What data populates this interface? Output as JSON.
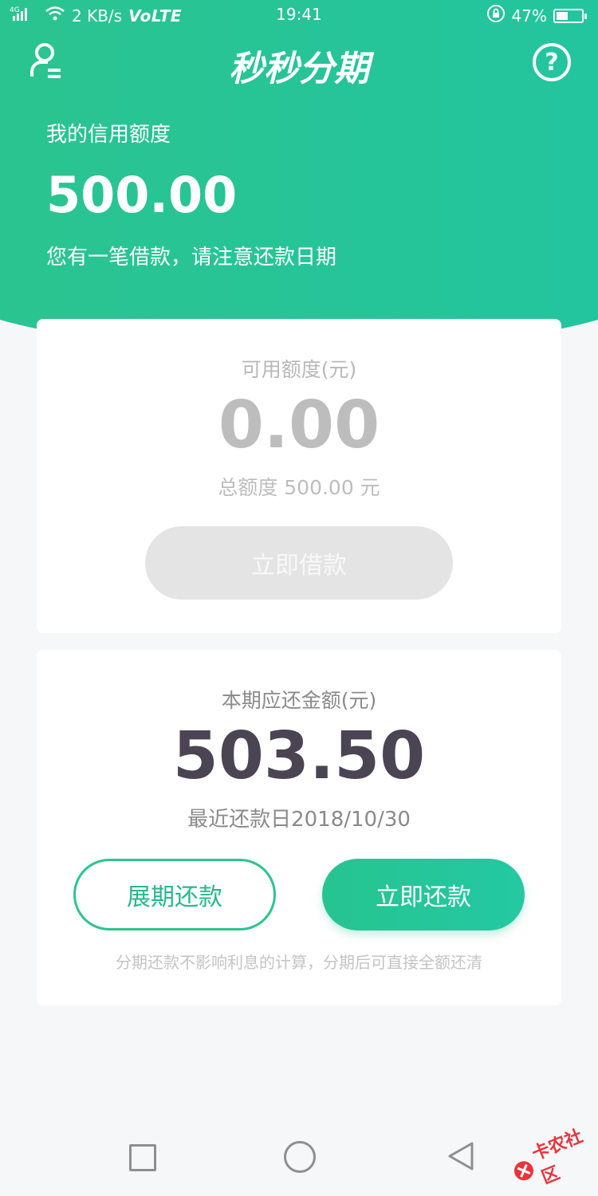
{
  "status_bar": {
    "network": "4G",
    "speed": "2 KB/s",
    "volte": "VoLTE",
    "time": "19:41",
    "battery_percent": "47%",
    "battery_level": 0.47
  },
  "header": {
    "title": "秒秒分期",
    "user_icon": "user-account-icon",
    "help_icon": "help-circle-icon",
    "help_glyph": "?"
  },
  "hero": {
    "label": "我的信用额度",
    "amount": "500.00",
    "notice": "您有一笔借款，请注意还款日期"
  },
  "credit_card": {
    "label": "可用额度(元)",
    "value": "0.00",
    "total": "总额度 500.00 元",
    "borrow_button": "立即借款"
  },
  "repay_card": {
    "label": "本期应还金额(元)",
    "amount": "503.50",
    "due_date": "最近还款日2018/10/30",
    "extend_button": "展期还款",
    "repay_button": "立即还款",
    "tip": "分期还款不影响利息的计算，分期后可直接全额还清"
  },
  "nav": {
    "recent_icon": "recent-apps-icon",
    "home_icon": "home-icon",
    "back_icon": "back-icon"
  },
  "watermark": {
    "text": "卡农社区"
  },
  "colors": {
    "brand_green": "#2bc48e",
    "accent_teal": "#22c5a0",
    "disabled_gray": "#e4e4e4",
    "amount_dark": "#4b4453"
  }
}
